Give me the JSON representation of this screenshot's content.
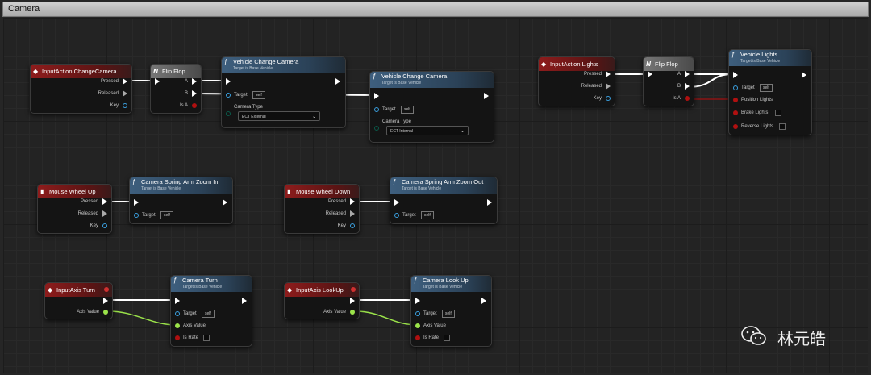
{
  "comment": {
    "title": "Camera"
  },
  "nodes": {
    "ia_change": {
      "title": "InputAction ChangeCamera",
      "pins": [
        "Pressed",
        "Released",
        "Key"
      ]
    },
    "flipflop1": {
      "title": "Flip Flop",
      "pins": [
        "A",
        "B",
        "Is A"
      ]
    },
    "vcc1": {
      "title": "Vehicle Change Camera",
      "subtitle": "Target is Base Vehicle",
      "target": "Target",
      "self": "self",
      "cam_label": "Camera Type",
      "cam_value": "ECT External"
    },
    "vcc2": {
      "title": "Vehicle Change Camera",
      "subtitle": "Target is Base Vehicle",
      "target": "Target",
      "self": "self",
      "cam_label": "Camera Type",
      "cam_value": "ECT Internal"
    },
    "ia_lights": {
      "title": "InputAction Lights",
      "pins": [
        "Pressed",
        "Released",
        "Key"
      ]
    },
    "flipflop2": {
      "title": "Flip Flop",
      "pins": [
        "A",
        "B",
        "Is A"
      ]
    },
    "vlights": {
      "title": "Vehicle Lights",
      "subtitle": "Target is Base Vehicle",
      "target": "Target",
      "self": "self",
      "pins": [
        "Position Lights",
        "Brake Lights",
        "Reverse Lights"
      ]
    },
    "mwu": {
      "title": "Mouse Wheel Up",
      "pins": [
        "Pressed",
        "Released",
        "Key"
      ]
    },
    "zoomin": {
      "title": "Camera Spring Arm Zoom In",
      "subtitle": "Target is Base Vehicle",
      "target": "Target",
      "self": "self"
    },
    "mwd": {
      "title": "Mouse Wheel Down",
      "pins": [
        "Pressed",
        "Released",
        "Key"
      ]
    },
    "zoomout": {
      "title": "Camera Spring Arm Zoom Out",
      "subtitle": "Target is Base Vehicle",
      "target": "Target",
      "self": "self"
    },
    "axis_turn": {
      "title": "InputAxis Turn",
      "pins": [
        "Axis Value"
      ]
    },
    "camturn": {
      "title": "Camera Turn",
      "subtitle": "Target is Base Vehicle",
      "target": "Target",
      "self": "self",
      "pins": [
        "Axis Value",
        "Is Rate"
      ]
    },
    "axis_look": {
      "title": "InputAxis LookUp",
      "pins": [
        "Axis Value"
      ]
    },
    "camlook": {
      "title": "Camera Look Up",
      "subtitle": "Target is Base Vehicle",
      "target": "Target",
      "self": "self",
      "pins": [
        "Axis Value",
        "Is Rate"
      ]
    }
  },
  "watermark": {
    "text": "林元皓",
    "icon": "wechat-icon"
  },
  "colors": {
    "exec": "#ffffff",
    "float": "#9be34a",
    "object": "#3aa0e0",
    "bool": "#b01010",
    "event_header": "#8e1c1c",
    "function_header": "#3e5f7e"
  }
}
